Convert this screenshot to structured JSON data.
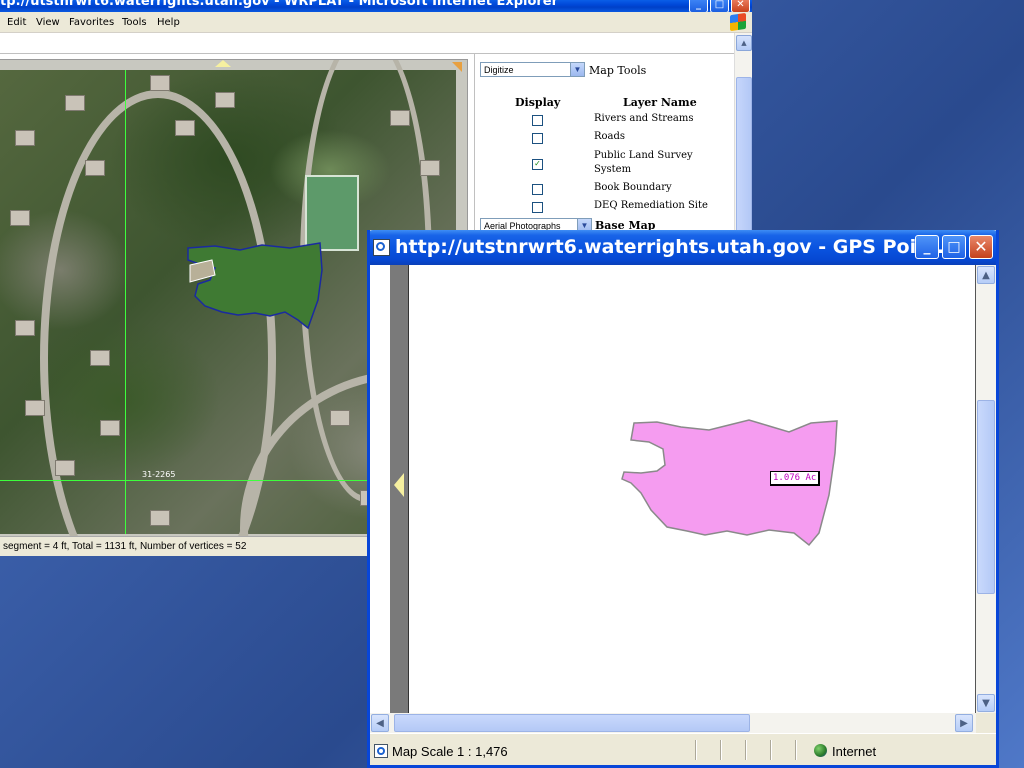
{
  "back_window": {
    "title": "tp://utstnrwrt6.waterrights.utah.gov - WRPLAT - Microsoft Internet Explorer",
    "menu": [
      "Edit",
      "View",
      "Favorites",
      "Tools",
      "Help"
    ],
    "map_label": "31-2265",
    "map_tools": {
      "select_value": "Digitize",
      "label": "Map Tools"
    },
    "layers_header": {
      "display": "Display",
      "layer_name": "Layer Name"
    },
    "layers": [
      {
        "name": "Rivers and Streams",
        "checked": false
      },
      {
        "name": "Roads",
        "checked": false
      },
      {
        "name": "Public Land Survey System",
        "checked": true
      },
      {
        "name": "Book Boundary",
        "checked": false
      },
      {
        "name": "DEQ Remediation Site",
        "checked": false
      }
    ],
    "base_map": {
      "select_value": "Aerial Photographs",
      "label": "Base Map"
    },
    "status": "segment = 4 ft, Total = 1131 ft, Number of vertices = 52"
  },
  "popup_window": {
    "title": "http://utstnrwrt6.waterrights.utah.gov - GPS Poin...",
    "acre_label": "1.076 Ac",
    "status": {
      "scale": "Map Scale 1 : 1,476",
      "zone": "Internet"
    },
    "polygon_fill": "#f59cf0",
    "polygon_stroke": "#8a8a8a"
  }
}
